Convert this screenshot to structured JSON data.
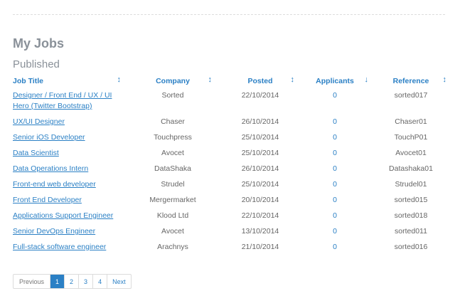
{
  "page": {
    "title": "My Jobs",
    "section": "Published"
  },
  "colors": {
    "accent": "#2b80c5",
    "heading": "#8a9199",
    "text": "#666666"
  },
  "table": {
    "headers": [
      "Job Title",
      "Company",
      "Posted",
      "Applicants",
      "Reference"
    ],
    "sort_icons": [
      "sort-both-icon",
      "sort-both-icon",
      "sort-both-icon",
      "sort-desc-icon",
      "sort-both-icon"
    ],
    "rows": [
      {
        "title": "Designer / Front End / UX / UI Hero (Twitter Bootstrap)",
        "company": "Sorted",
        "posted": "22/10/2014",
        "applicants": "0",
        "reference": "sorted017"
      },
      {
        "title": "UX/UI Designer",
        "company": "Chaser",
        "posted": "26/10/2014",
        "applicants": "0",
        "reference": "Chaser01"
      },
      {
        "title": "Senior iOS Developer",
        "company": "Touchpress",
        "posted": "25/10/2014",
        "applicants": "0",
        "reference": "TouchP01"
      },
      {
        "title": "Data Scientist",
        "company": "Avocet",
        "posted": "25/10/2014",
        "applicants": "0",
        "reference": "Avocet01"
      },
      {
        "title": "Data Operations Intern",
        "company": "DataShaka",
        "posted": "26/10/2014",
        "applicants": "0",
        "reference": "Datashaka01"
      },
      {
        "title": "Front-end web developer",
        "company": "Strudel",
        "posted": "25/10/2014",
        "applicants": "0",
        "reference": "Strudel01"
      },
      {
        "title": "Front End Developer",
        "company": "Mergermarket",
        "posted": "20/10/2014",
        "applicants": "0",
        "reference": "sorted015"
      },
      {
        "title": "Applications Support Engineer",
        "company": "Klood Ltd",
        "posted": "22/10/2014",
        "applicants": "0",
        "reference": "sorted018"
      },
      {
        "title": "Senior DevOps Engineer",
        "company": "Avocet",
        "posted": "13/10/2014",
        "applicants": "0",
        "reference": "sorted011"
      },
      {
        "title": "Full-stack software engineer",
        "company": "Arachnys",
        "posted": "21/10/2014",
        "applicants": "0",
        "reference": "sorted016"
      }
    ]
  },
  "pagination": {
    "previous": "Previous",
    "pages": [
      "1",
      "2",
      "3",
      "4"
    ],
    "current": "1",
    "next": "Next"
  }
}
